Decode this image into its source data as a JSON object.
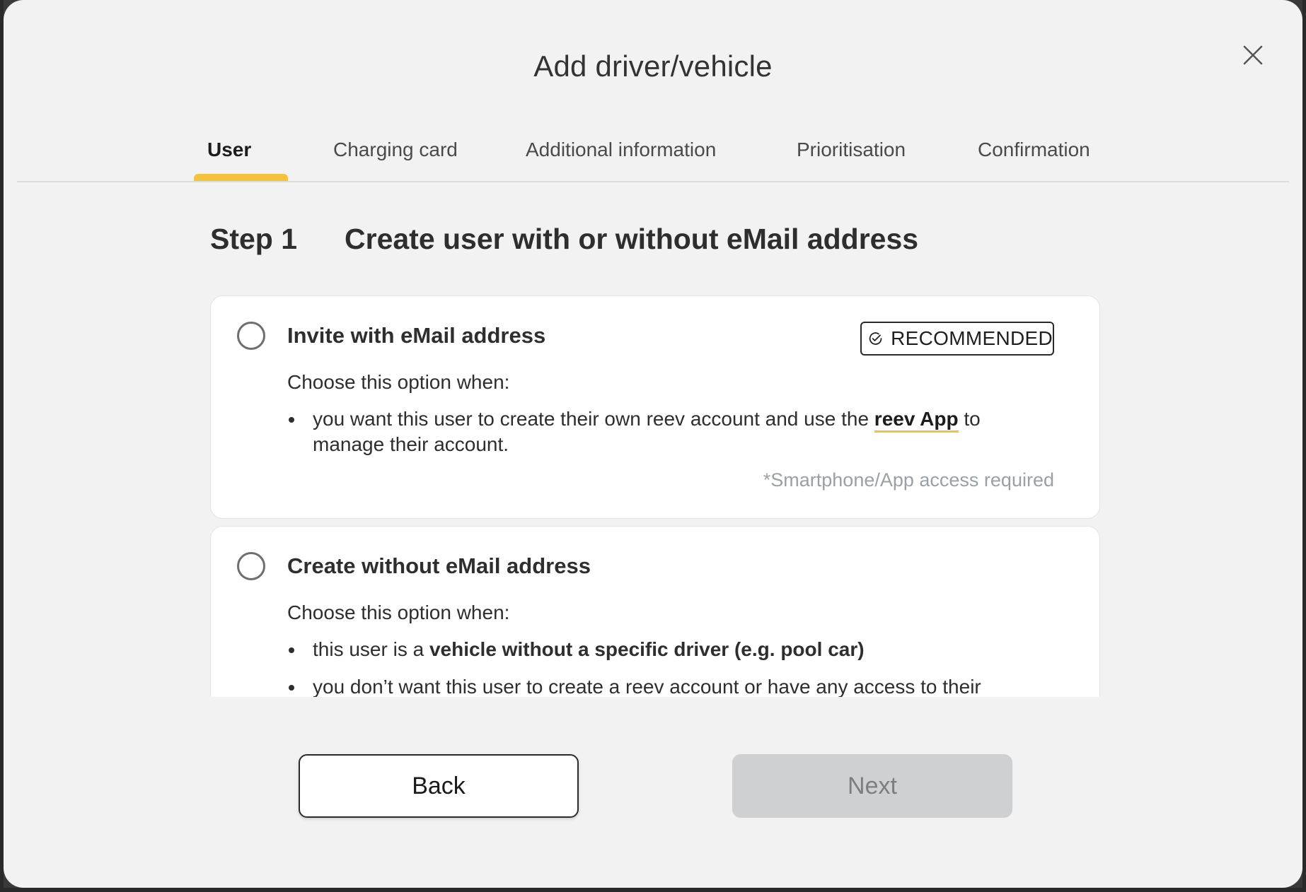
{
  "modal": {
    "title": "Add driver/vehicle",
    "close_icon": "close-icon"
  },
  "tabs": [
    {
      "label": "User",
      "active": true
    },
    {
      "label": "Charging card",
      "active": false
    },
    {
      "label": "Additional information",
      "active": false
    },
    {
      "label": "Prioritisation",
      "active": false
    },
    {
      "label": "Confirmation",
      "active": false
    }
  ],
  "step": {
    "number": "Step 1",
    "title": "Create user with or without eMail address"
  },
  "options": [
    {
      "title": "Invite with eMail address",
      "badge": "RECOMMENDED",
      "badge_icon": "check-circle-icon",
      "lead": "Choose this option when:",
      "bullet_1_pre": "you want this user to create their own reev account and use the ",
      "bullet_1_link": "reev App",
      "bullet_1_post": " to manage their account.",
      "note": "*Smartphone/App access required"
    },
    {
      "title": "Create without eMail address",
      "lead": "Choose this option when:",
      "bullet_1_pre": "this user is a ",
      "bullet_1_bold": "vehicle without a specific driver (e.g. pool car)",
      "bullet_2": "you don’t want this user to create a reev account or have any access to their"
    }
  ],
  "buttons": {
    "back_label": "Back",
    "next_label": "Next"
  },
  "colors": {
    "accent": "#f5c33b",
    "modal_bg": "#f2f2f2",
    "disabled_bg": "#cfd0d2"
  }
}
